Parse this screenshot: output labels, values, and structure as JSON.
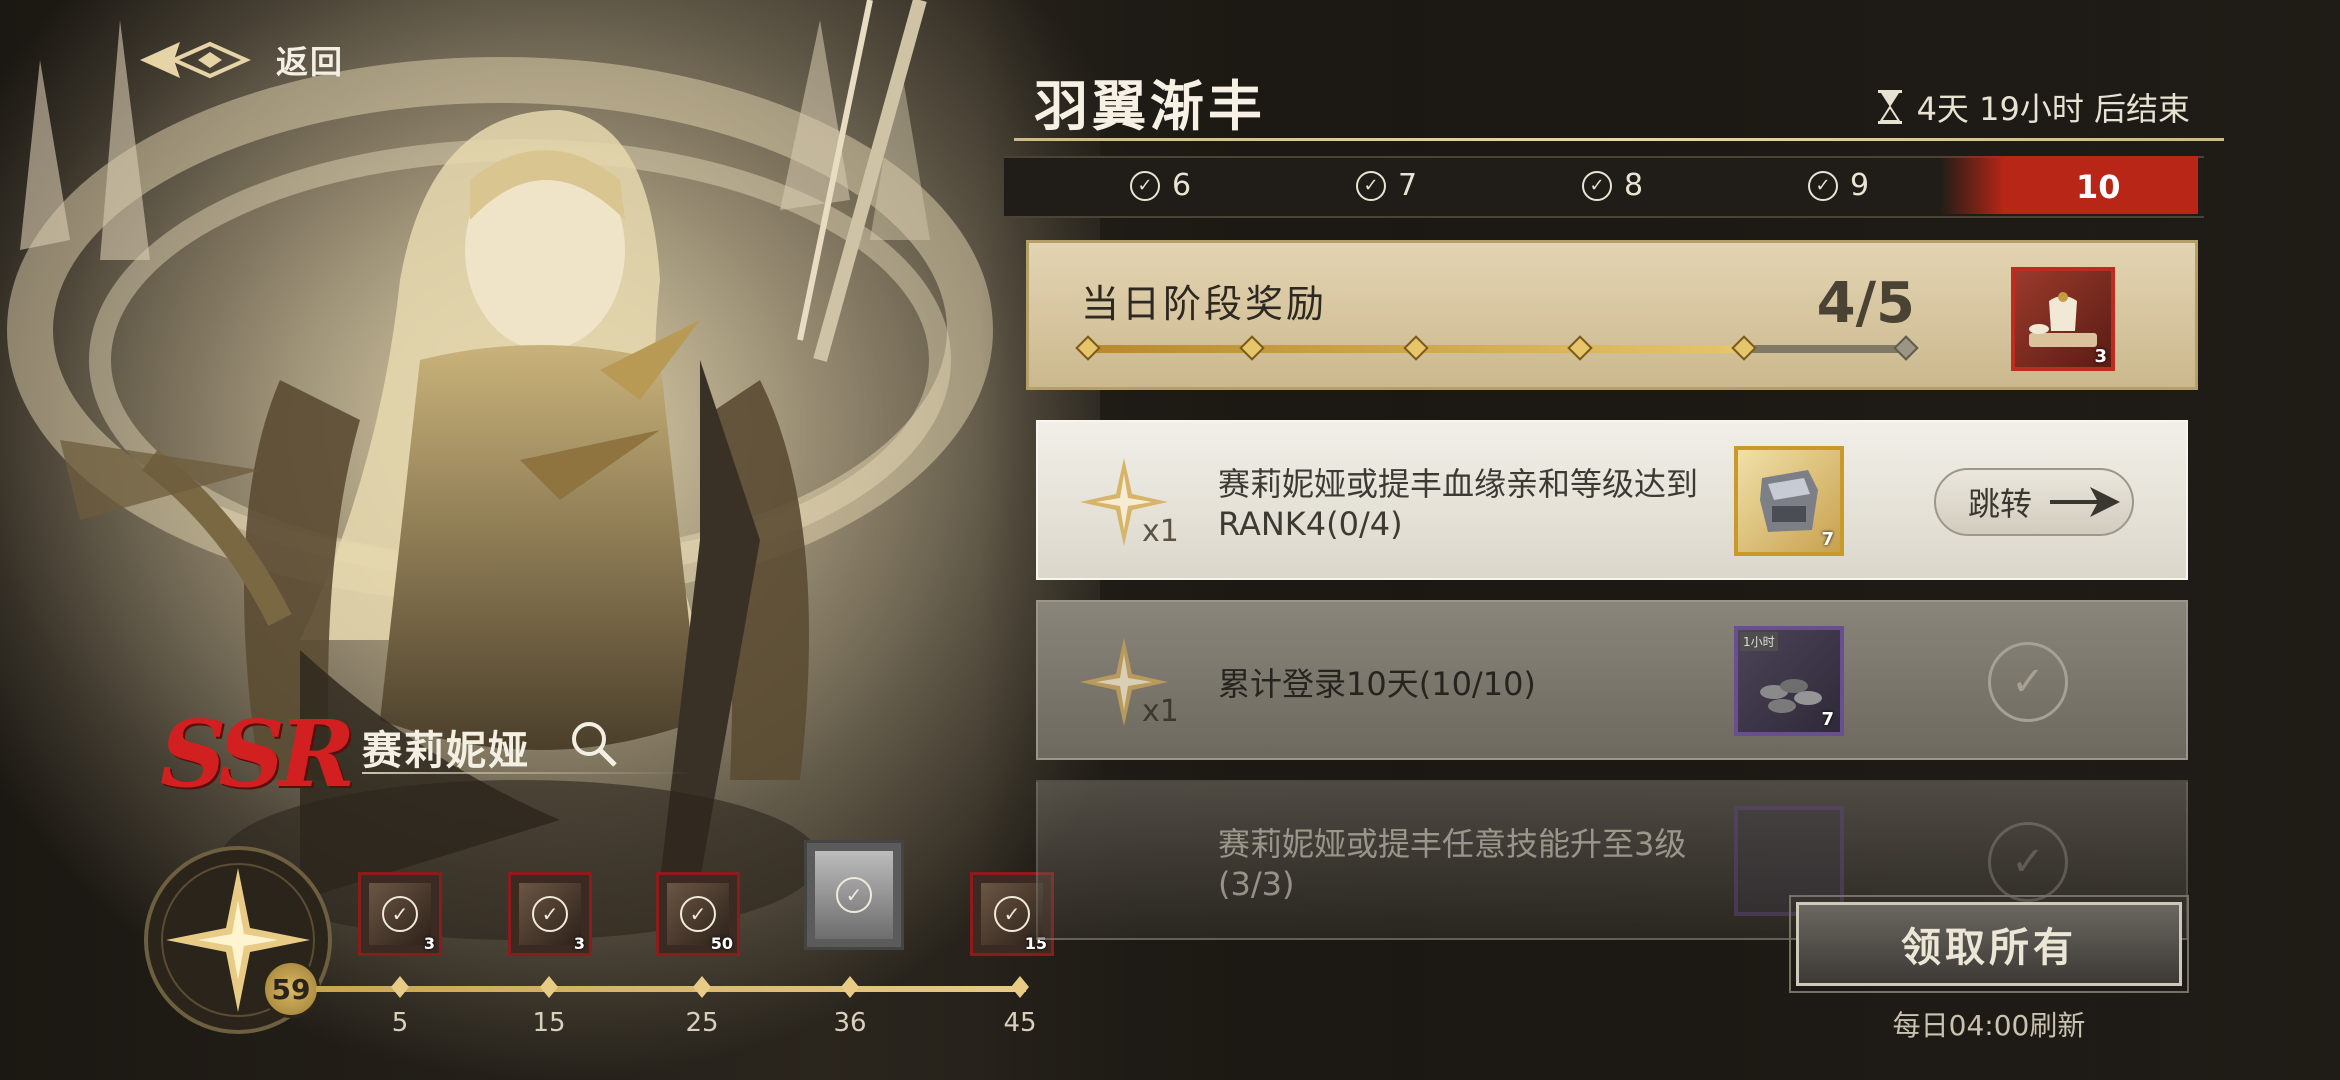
{
  "header": {
    "back_label": "返回"
  },
  "character": {
    "rarity": "SSR",
    "name": "赛莉妮娅",
    "level": "59"
  },
  "track": {
    "milestones": [
      {
        "label": "5",
        "reward_qty": "3"
      },
      {
        "label": "15",
        "reward_qty": "3"
      },
      {
        "label": "25",
        "reward_qty": "50"
      },
      {
        "label": "36",
        "reward_qty": ""
      },
      {
        "label": "45",
        "reward_qty": "15"
      }
    ]
  },
  "event": {
    "title": "羽翼渐丰",
    "timer": "4天 19小时 后结束",
    "days": [
      "6",
      "7",
      "8",
      "9"
    ],
    "active_day": "10"
  },
  "stage_reward": {
    "title": "当日阶段奖励",
    "count": "4/5",
    "progress": 0.8,
    "reward_qty": "3"
  },
  "quests": [
    {
      "multiplier": "x1",
      "text": "赛莉妮娅或提丰血缘亲和等级达到RANK4(0/4)",
      "reward_qty": "7",
      "action": "跳转"
    },
    {
      "multiplier": "x1",
      "text": "累计登录10天(10/10)",
      "reward_qty": "7",
      "reward_tag": "1小时"
    },
    {
      "multiplier": "x1",
      "text": "赛莉妮娅或提丰任意技能升至3级(3/3)"
    }
  ],
  "footer": {
    "claim_all": "领取所有",
    "refresh_note": "每日04:00刷新"
  },
  "colors": {
    "accent_red": "#b72617",
    "gold": "#e6c56b",
    "cream": "#e3d4b2"
  }
}
